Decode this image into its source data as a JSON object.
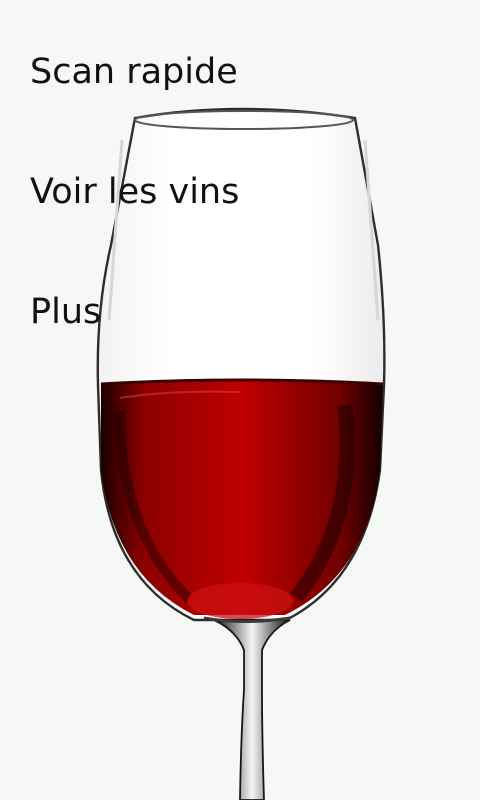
{
  "menu": {
    "items": [
      {
        "label": "Scan rapide"
      },
      {
        "label": "Voir les vins"
      },
      {
        "label": "Plus"
      }
    ]
  },
  "background": {
    "image": "red-wine-glass",
    "wine_color": "#b30000",
    "background_color": "#f6f8f6"
  }
}
